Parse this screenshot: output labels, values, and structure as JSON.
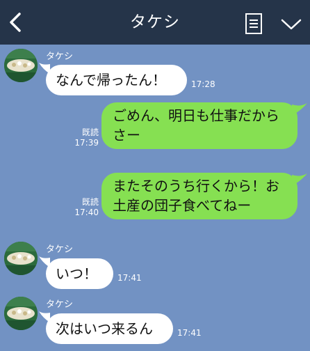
{
  "header": {
    "title": "タケシ",
    "colors": {
      "bar": "#253449",
      "text": "#ffffff"
    }
  },
  "chat": {
    "colors": {
      "background": "#7292c3",
      "incoming": "#ffffff",
      "outgoing": "#86e052"
    },
    "messages": [
      {
        "direction": "in",
        "sender": "タケシ",
        "text": "なんで帰ったん！",
        "time": "17:28"
      },
      {
        "direction": "out",
        "read_label": "既読",
        "text_line1": "ごめん、明日も仕事だから",
        "text_line2": "さー",
        "time": "17:39"
      },
      {
        "direction": "out",
        "read_label": "既読",
        "text_line1": "またそのうち行くから！お",
        "text_line2": "土産の団子食べてねー",
        "time": "17:40"
      },
      {
        "direction": "in",
        "sender": "タケシ",
        "text": "いつ！",
        "time": "17:41"
      },
      {
        "direction": "in",
        "sender": "タケシ",
        "text": "次はいつ来るん",
        "time": "17:41"
      }
    ]
  }
}
